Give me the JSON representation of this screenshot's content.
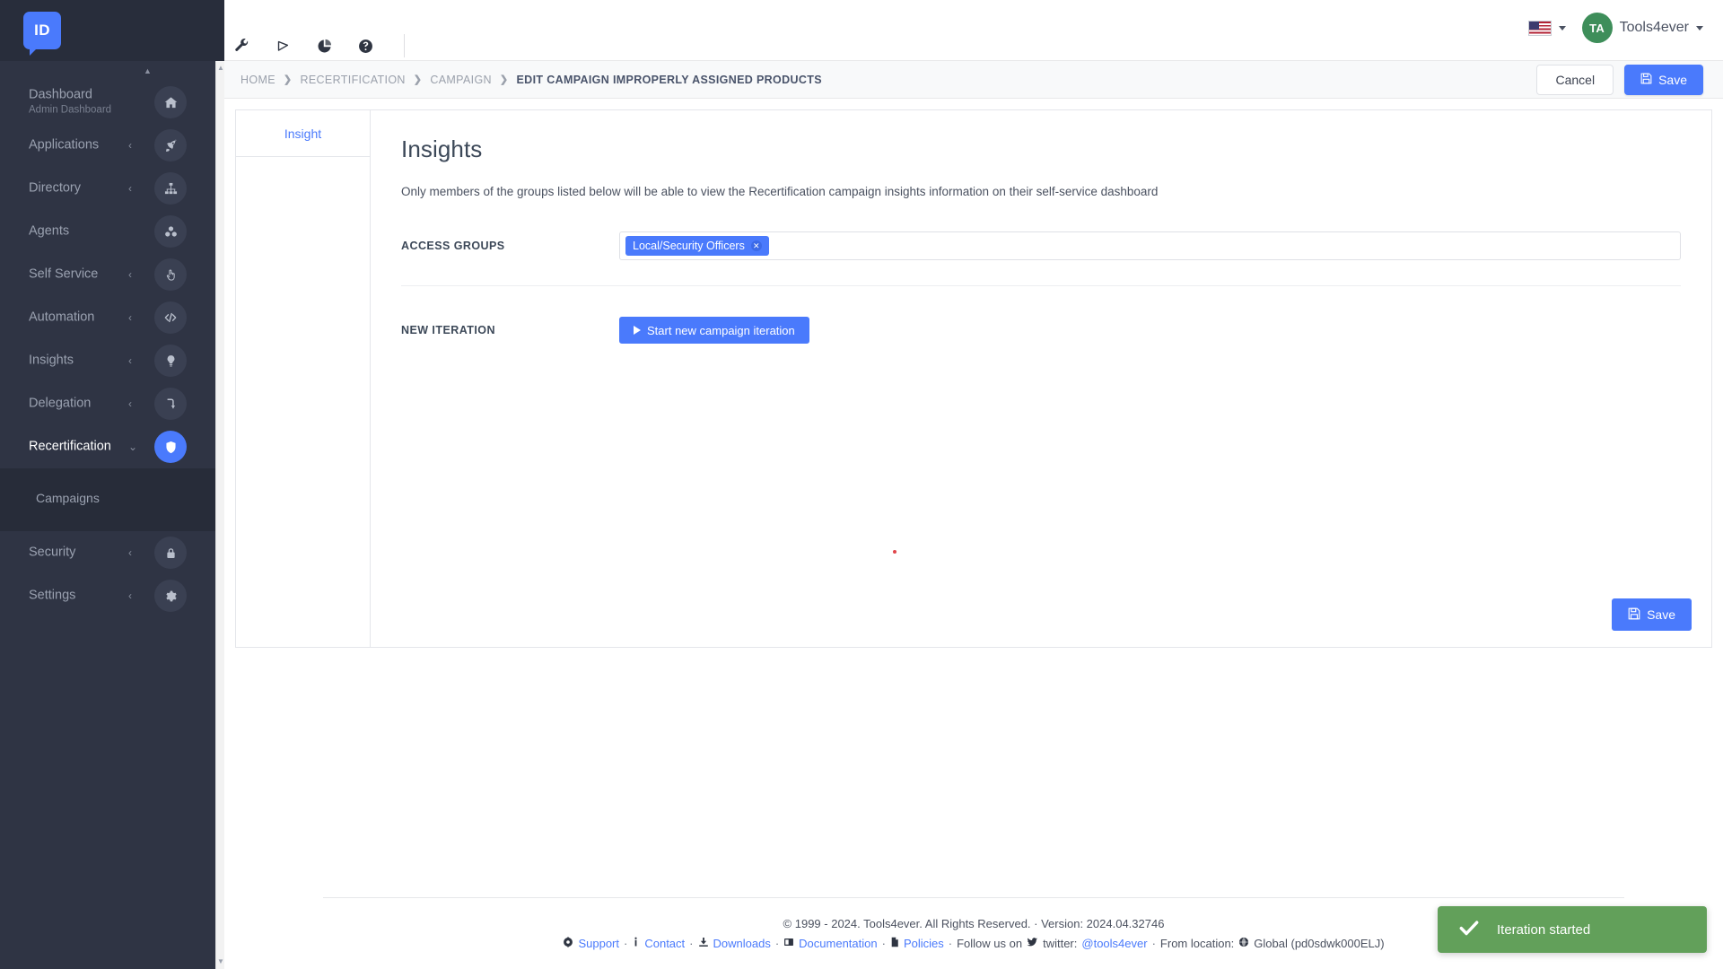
{
  "brand": {
    "logo_text": "ID",
    "accent_color": "#4a7afc",
    "sidebar_color": "#2f3444"
  },
  "sidebar": {
    "items": [
      {
        "label": "Dashboard",
        "sublabel": "Admin Dashboard",
        "icon": "home-icon",
        "caret": "",
        "active": false
      },
      {
        "label": "Applications",
        "sublabel": "",
        "icon": "rocket-icon",
        "caret": "‹",
        "active": false
      },
      {
        "label": "Directory",
        "sublabel": "",
        "icon": "sitemap-icon",
        "caret": "‹",
        "active": false
      },
      {
        "label": "Agents",
        "sublabel": "",
        "icon": "cubes-icon",
        "caret": "",
        "active": false
      },
      {
        "label": "Self Service",
        "sublabel": "",
        "icon": "hand-pointer-icon",
        "caret": "‹",
        "active": false
      },
      {
        "label": "Automation",
        "sublabel": "",
        "icon": "code-icon",
        "caret": "‹",
        "active": false
      },
      {
        "label": "Insights",
        "sublabel": "",
        "icon": "lightbulb-icon",
        "caret": "‹",
        "active": false
      },
      {
        "label": "Delegation",
        "sublabel": "",
        "icon": "share-arrow-icon",
        "caret": "‹",
        "active": false
      },
      {
        "label": "Recertification",
        "sublabel": "",
        "icon": "shield-icon",
        "caret": "⌄",
        "active": true
      },
      {
        "label": "Security",
        "sublabel": "",
        "icon": "lock-icon",
        "caret": "‹",
        "active": false
      },
      {
        "label": "Settings",
        "sublabel": "",
        "icon": "gear-icon",
        "caret": "‹",
        "active": false
      }
    ],
    "submenu": {
      "parent": "Recertification",
      "items": [
        {
          "label": "Campaigns"
        }
      ]
    }
  },
  "topbar": {
    "tools": [
      {
        "name": "wrench-icon"
      },
      {
        "name": "flask-icon"
      },
      {
        "name": "pie-chart-icon"
      },
      {
        "name": "help-circle-icon"
      }
    ],
    "language": {
      "name": "us-flag-icon",
      "code": "US"
    },
    "user": {
      "initials": "TA",
      "name": "Tools4ever",
      "avatar_color": "#3e8e5a"
    }
  },
  "breadcrumb": {
    "items": [
      {
        "label": "HOME",
        "current": false
      },
      {
        "label": "RECERTIFICATION",
        "current": false
      },
      {
        "label": "CAMPAIGN",
        "current": false
      },
      {
        "label": "EDIT CAMPAIGN IMPROPERLY ASSIGNED PRODUCTS",
        "current": true
      }
    ],
    "separator": "❯",
    "cancel_label": "Cancel",
    "save_label": "Save"
  },
  "panel": {
    "tabs": [
      {
        "label": "Insight",
        "active": true
      }
    ],
    "title": "Insights",
    "description": "Only members of the groups listed below will be able to view the Recertification campaign insights information on their self-service dashboard",
    "access_groups": {
      "label": "ACCESS GROUPS",
      "tags": [
        {
          "text": "Local/Security Officers",
          "remove": "✕"
        }
      ]
    },
    "new_iteration": {
      "label": "NEW ITERATION",
      "button_label": "Start new campaign iteration"
    },
    "save_label": "Save"
  },
  "footer": {
    "copyright": "© 1999 - 2024. Tools4ever. All Rights Reserved. · Version: 2024.04.32746",
    "links": [
      {
        "icon": "support-icon",
        "label": "Support"
      },
      {
        "icon": "info-icon",
        "label": "Contact"
      },
      {
        "icon": "download-icon",
        "label": "Downloads"
      },
      {
        "icon": "documentation-icon",
        "label": "Documentation"
      },
      {
        "icon": "policies-icon",
        "label": "Policies"
      }
    ],
    "follow_text": "Follow us on",
    "twitter_icon": "twitter-icon",
    "twitter_prefix": "twitter:",
    "twitter_handle": "@tools4ever",
    "location_prefix": "From location:",
    "location_icon": "globe-icon",
    "location_value": "Global (pd0sdwk000ELJ)",
    "separator": "·"
  },
  "toast": {
    "icon": "check-icon",
    "message": "Iteration started",
    "color": "#62a05a"
  }
}
